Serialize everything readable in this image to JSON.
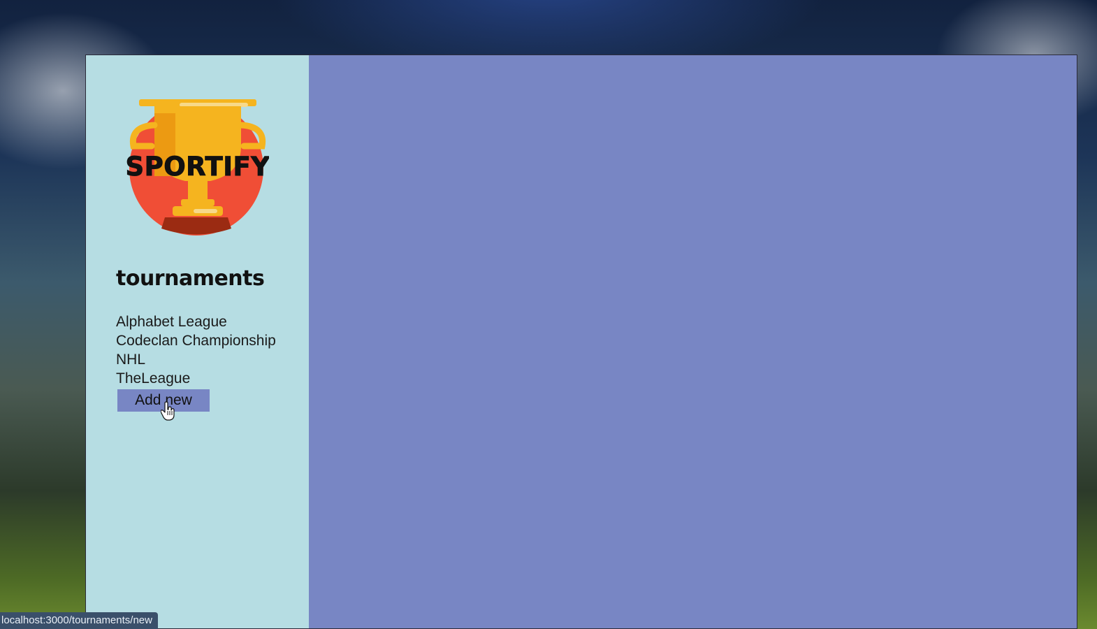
{
  "app": {
    "logo_text": "SPORTIFY",
    "logo_icon": "trophy-icon"
  },
  "sidebar": {
    "heading": "tournaments",
    "tournaments": [
      {
        "label": "Alphabet League"
      },
      {
        "label": "Codeclan Championship"
      },
      {
        "label": "NHL"
      },
      {
        "label": "TheLeague"
      }
    ],
    "add_button_label": "Add new"
  },
  "status_bar": {
    "url": "localhost:3000/tournaments/new"
  },
  "colors": {
    "sidebar_bg": "#b6dde3",
    "main_bg": "#7886c4",
    "button_bg": "#7886c4",
    "logo_circle": "#f04e36",
    "trophy": "#f5b41f"
  }
}
